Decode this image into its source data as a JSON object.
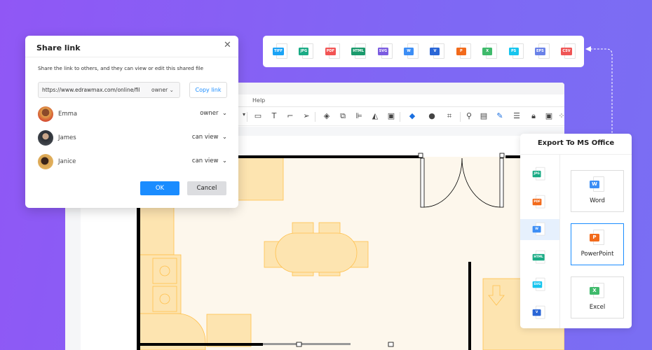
{
  "app": {
    "menu_help": "Help"
  },
  "share_dialog": {
    "title": "Share link",
    "description": "Share the link to others, and they can view or edit this shared file",
    "link_url": "https://www.edrawmax.com/online/fil",
    "link_permission": "owner",
    "copy_label": "Copy link",
    "users": [
      {
        "name": "Emma",
        "role": "owner"
      },
      {
        "name": "James",
        "role": "can view"
      },
      {
        "name": "Janice",
        "role": "can view"
      }
    ],
    "ok_label": "OK",
    "cancel_label": "Cancel"
  },
  "formats": [
    {
      "label": "TIFF",
      "color": "#1aa3f5"
    },
    {
      "label": "JPG",
      "color": "#1aab85"
    },
    {
      "label": "PDF",
      "color": "#f25454"
    },
    {
      "label": "HTML",
      "color": "#1a9a6c"
    },
    {
      "label": "SVG",
      "color": "#7b5ce0"
    },
    {
      "label": "W",
      "color": "#3d8ef5"
    },
    {
      "label": "V",
      "color": "#2a66d6"
    },
    {
      "label": "P",
      "color": "#f26a1b"
    },
    {
      "label": "X",
      "color": "#3fba6b"
    },
    {
      "label": "PS",
      "color": "#17c5ee"
    },
    {
      "label": "EPS",
      "color": "#6a82e8"
    },
    {
      "label": "CSV",
      "color": "#ef5555"
    }
  ],
  "export_panel": {
    "title": "Export To MS Office",
    "side": [
      {
        "label": "JPG",
        "color": "#1aab85"
      },
      {
        "label": "PDF",
        "color": "#f26a1b"
      },
      {
        "label": "W",
        "color": "#3d8ef5"
      },
      {
        "label": "HTML",
        "color": "#1aab85"
      },
      {
        "label": "SVG",
        "color": "#17c5ee"
      },
      {
        "label": "V",
        "color": "#2a66d6"
      }
    ],
    "options": [
      {
        "label": "Word",
        "icon": "W",
        "color": "#3d8ef5"
      },
      {
        "label": "PowerPoint",
        "icon": "P",
        "color": "#f26a1b"
      },
      {
        "label": "Excel",
        "icon": "X",
        "color": "#3fba6b"
      }
    ]
  }
}
